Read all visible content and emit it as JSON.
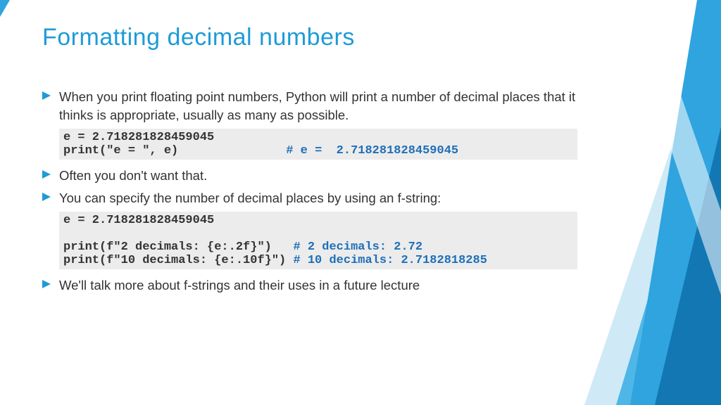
{
  "title": "Formatting decimal numbers",
  "bullets": {
    "b1": "When you print floating point numbers, Python will print a number of decimal places that it thinks is appropriate, usually as many as possible.",
    "b2": "Often you don't want that.",
    "b3": "You can specify the number of decimal places by using an f-string:",
    "b4": "We'll talk more about f-strings and their uses in a future lecture"
  },
  "code1": {
    "line1": "e = 2.718281828459045",
    "line2a": "print(\"e = \", e)               ",
    "line2b": "# e =  2.718281828459045"
  },
  "code2": {
    "line1": "e = 2.718281828459045",
    "blank": " ",
    "line2a": "print(f\"2 decimals: {e:.2f}\")   ",
    "line2b": "# 2 decimals: 2.72",
    "line3a": "print(f\"10 decimals: {e:.10f}\") ",
    "line3b": "# 10 decimals: 2.7182818285"
  },
  "colors": {
    "accent": "#1e9bd7"
  }
}
